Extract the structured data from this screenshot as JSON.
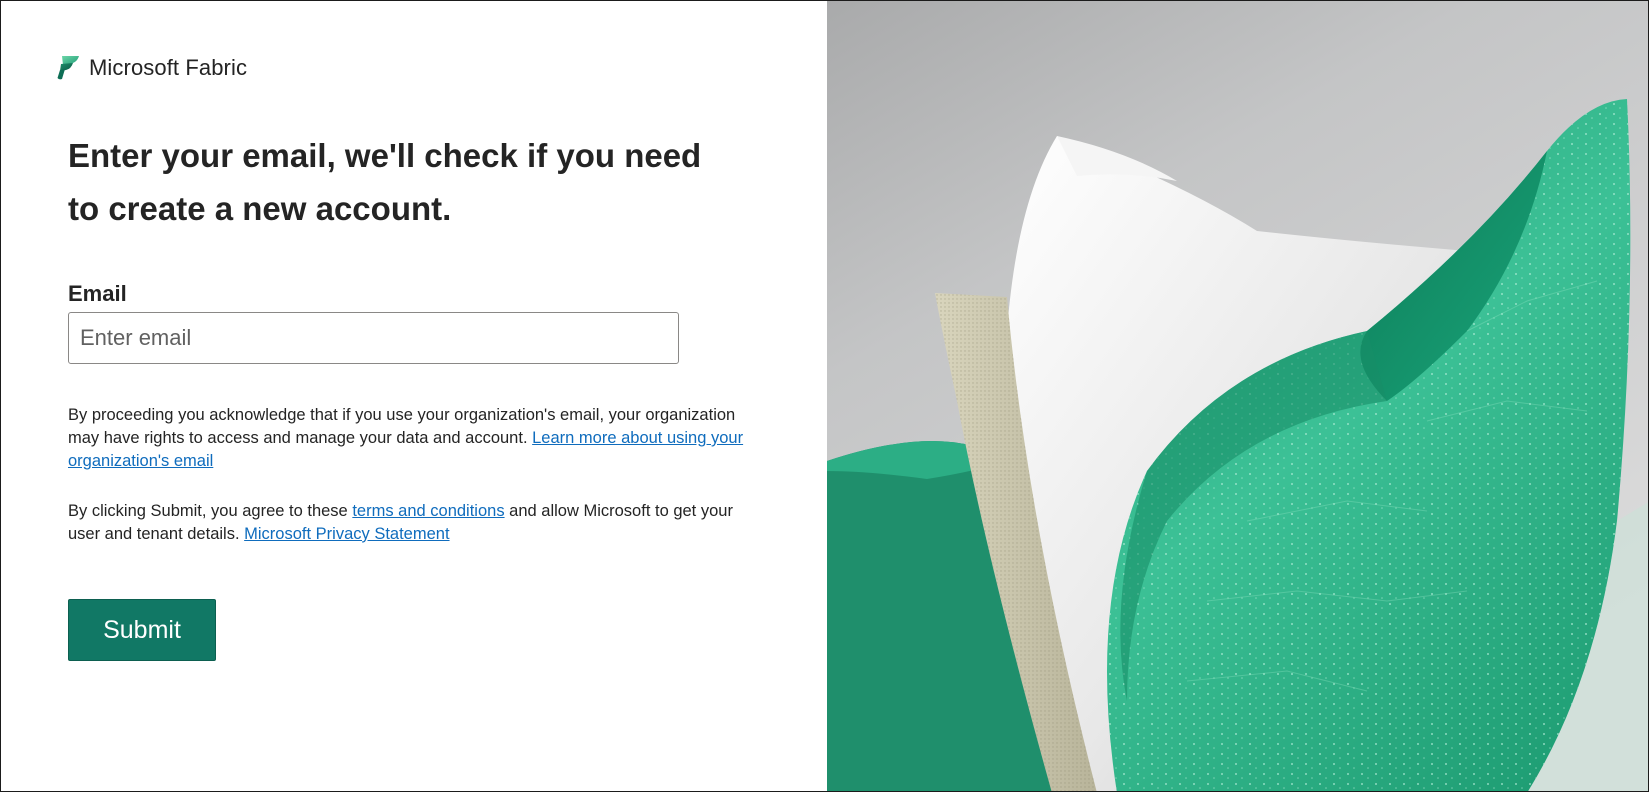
{
  "brand": {
    "logo_icon": "fabric-logo-icon",
    "name": "Microsoft Fabric"
  },
  "headline": "Enter your email, we'll check if you need to create a new account.",
  "form": {
    "email_label": "Email",
    "email_value": "",
    "email_placeholder": "Enter email",
    "submit_label": "Submit"
  },
  "notices": {
    "org_text": "By proceeding you acknowledge that if you use your organization's email, your organization may have rights to access and manage your data and account.",
    "org_link": "Learn more about using your organization's email",
    "terms_prefix": "By clicking Submit, you agree to these",
    "terms_link": "terms and conditions",
    "terms_middle": "and allow Microsoft to get your user and tenant details.",
    "privacy_link": "Microsoft Privacy Statement"
  },
  "theme": {
    "accent": "#117865",
    "link": "#0f6cbd",
    "text": "#242424"
  },
  "hero": {
    "illustration_icon": "fabric-leaf-illustration"
  }
}
